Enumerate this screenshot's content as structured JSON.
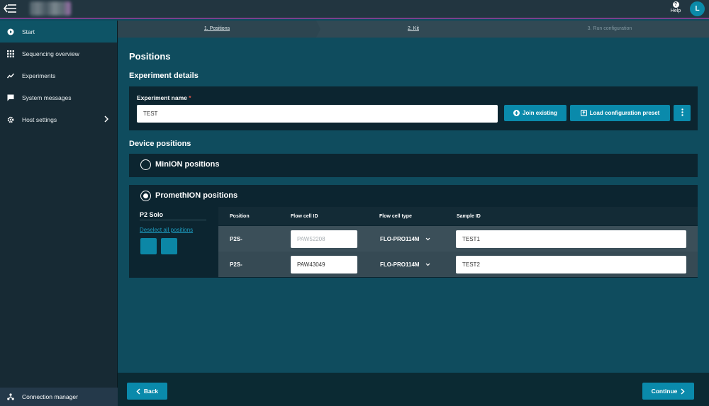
{
  "topbar": {
    "help_label": "Help",
    "avatar_initial": "L"
  },
  "sidebar": {
    "items": [
      {
        "label": "Start",
        "icon": "play-circle-icon",
        "active": true
      },
      {
        "label": "Sequencing overview",
        "icon": "grid-icon",
        "active": false
      },
      {
        "label": "Experiments",
        "icon": "trend-icon",
        "active": false
      },
      {
        "label": "System messages",
        "icon": "message-icon",
        "active": false
      },
      {
        "label": "Host settings",
        "icon": "gear-icon",
        "active": false,
        "has_chevron": true
      }
    ],
    "bottom": {
      "label": "Connection manager",
      "icon": "network-icon"
    }
  },
  "stepper": {
    "steps": [
      "1. Positions",
      "2. Kit",
      "3. Run configuration"
    ]
  },
  "main": {
    "title": "Positions",
    "experiment_section": "Experiment details",
    "experiment_name_label": "Experiment name",
    "required_mark": "*",
    "experiment_name_value": "TEST",
    "join_existing_label": "Join existing",
    "load_preset_label": "Load configuration preset",
    "device_section": "Device positions",
    "minion_label": "MinION positions",
    "promethion_label": "PromethION positions",
    "p2_title": "P2 Solo",
    "deselect_label": "Deselect all positions",
    "table": {
      "headers": [
        "Position",
        "Flow cell ID",
        "Flow cell type",
        "Sample ID"
      ],
      "rows": [
        {
          "position": "P2S-",
          "flow_cell_id": "PAW52208",
          "flow_cell_id_is_placeholder": true,
          "flow_cell_type": "FLO-PRO114M",
          "sample_id": "TEST1"
        },
        {
          "position": "P2S-",
          "flow_cell_id": "PAW43049",
          "flow_cell_id_is_placeholder": false,
          "flow_cell_type": "FLO-PRO114M",
          "sample_id": "TEST2"
        }
      ]
    }
  },
  "footer": {
    "back_label": "Back",
    "continue_label": "Continue"
  },
  "colors": {
    "accent": "#0a8aab",
    "required": "#e2574c",
    "brand_line": "#7b3f8c"
  }
}
